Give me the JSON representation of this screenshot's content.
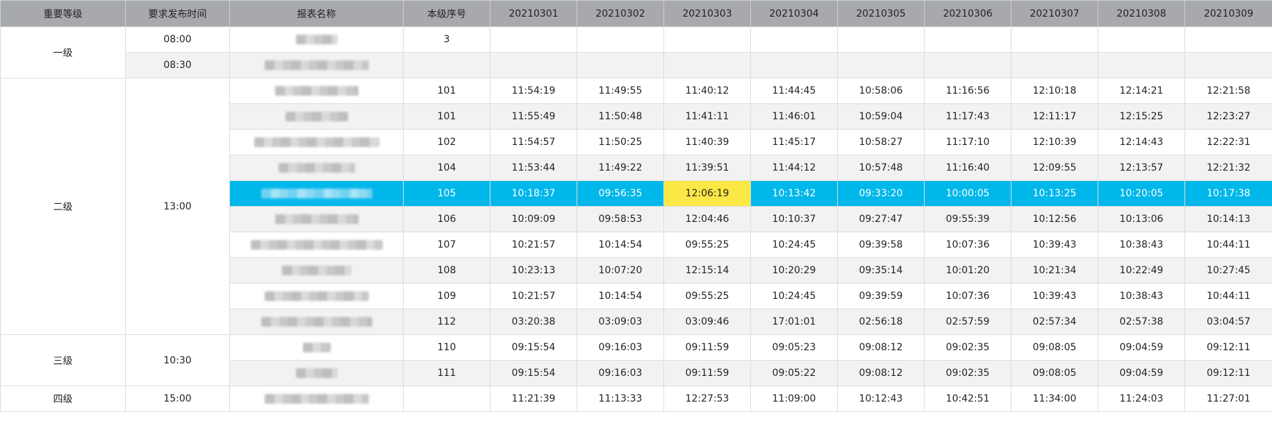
{
  "columns": [
    "重要等级",
    "要求发布时间",
    "报表名称",
    "本级序号",
    "20210301",
    "20210302",
    "20210303",
    "20210304",
    "20210305",
    "20210306",
    "20210307",
    "20210308",
    "20210309"
  ],
  "colors": {
    "header_bg": "#a7a9ad",
    "selected_row": "#00b7ea",
    "highlight": "#fce844",
    "stripe": "#f2f2f2"
  },
  "groups": [
    {
      "level": "一级",
      "rows": [
        {
          "time": "08:00",
          "seq": "3",
          "values": [
            "",
            "",
            "",
            "",
            "",
            "",
            "",
            "",
            ""
          ],
          "highlight": []
        },
        {
          "time": "08:30",
          "seq": "",
          "values": [
            "",
            "",
            "",
            "",
            "",
            "",
            "",
            "",
            ""
          ],
          "highlight": []
        }
      ]
    },
    {
      "level": "二级",
      "time": "13:00",
      "rows": [
        {
          "seq": "101",
          "values": [
            "11:54:19",
            "11:49:55",
            "11:40:12",
            "11:44:45",
            "10:58:06",
            "11:16:56",
            "12:10:18",
            "12:14:21",
            "12:21:58"
          ],
          "highlight": []
        },
        {
          "seq": "101",
          "values": [
            "11:55:49",
            "11:50:48",
            "11:41:11",
            "11:46:01",
            "10:59:04",
            "11:17:43",
            "12:11:17",
            "12:15:25",
            "12:23:27"
          ],
          "highlight": []
        },
        {
          "seq": "102",
          "values": [
            "11:54:57",
            "11:50:25",
            "11:40:39",
            "11:45:17",
            "10:58:27",
            "11:17:10",
            "12:10:39",
            "12:14:43",
            "12:22:31"
          ],
          "highlight": []
        },
        {
          "seq": "104",
          "values": [
            "11:53:44",
            "11:49:22",
            "11:39:51",
            "11:44:12",
            "10:57:48",
            "11:16:40",
            "12:09:55",
            "12:13:57",
            "12:21:32"
          ],
          "highlight": []
        },
        {
          "seq": "105",
          "selected": true,
          "values": [
            "10:18:37",
            "09:56:35",
            "12:06:19",
            "10:13:42",
            "09:33:20",
            "10:00:05",
            "10:13:25",
            "10:20:05",
            "10:17:38"
          ],
          "highlight": [
            2
          ]
        },
        {
          "seq": "106",
          "values": [
            "10:09:09",
            "09:58:53",
            "12:04:46",
            "10:10:37",
            "09:27:47",
            "09:55:39",
            "10:12:56",
            "10:13:06",
            "10:14:13"
          ],
          "highlight": [
            2
          ]
        },
        {
          "seq": "107",
          "values": [
            "10:21:57",
            "10:14:54",
            "09:55:25",
            "10:24:45",
            "09:39:58",
            "10:07:36",
            "10:39:43",
            "10:38:43",
            "10:44:11"
          ],
          "highlight": [
            6,
            7,
            8
          ]
        },
        {
          "seq": "108",
          "values": [
            "10:23:13",
            "10:07:20",
            "12:15:14",
            "10:20:29",
            "09:35:14",
            "10:01:20",
            "10:21:34",
            "10:22:49",
            "10:27:45"
          ],
          "highlight": [
            2
          ]
        },
        {
          "seq": "109",
          "values": [
            "10:21:57",
            "10:14:54",
            "09:55:25",
            "10:24:45",
            "09:39:59",
            "10:07:36",
            "10:39:43",
            "10:38:43",
            "10:44:11"
          ],
          "highlight": [
            6,
            7,
            8
          ]
        },
        {
          "seq": "112",
          "values": [
            "03:20:38",
            "03:09:03",
            "03:09:46",
            "17:01:01",
            "02:56:18",
            "02:57:59",
            "02:57:34",
            "02:57:38",
            "03:04:57"
          ],
          "highlight": [
            3
          ]
        }
      ]
    },
    {
      "level": "三级",
      "time": "10:30",
      "rows": [
        {
          "seq": "110",
          "values": [
            "09:15:54",
            "09:16:03",
            "09:11:59",
            "09:05:23",
            "09:08:12",
            "09:02:35",
            "09:08:05",
            "09:04:59",
            "09:12:11"
          ],
          "highlight": []
        },
        {
          "seq": "111",
          "values": [
            "09:15:54",
            "09:16:03",
            "09:11:59",
            "09:05:22",
            "09:08:12",
            "09:02:35",
            "09:08:05",
            "09:04:59",
            "09:12:11"
          ],
          "highlight": []
        }
      ]
    },
    {
      "level": "四级",
      "time": "15:00",
      "rows": [
        {
          "seq": "",
          "values": [
            "11:21:39",
            "11:13:33",
            "12:27:53",
            "11:09:00",
            "10:12:43",
            "10:42:51",
            "11:34:00",
            "11:24:03",
            "11:27:01"
          ],
          "highlight": []
        }
      ]
    }
  ]
}
